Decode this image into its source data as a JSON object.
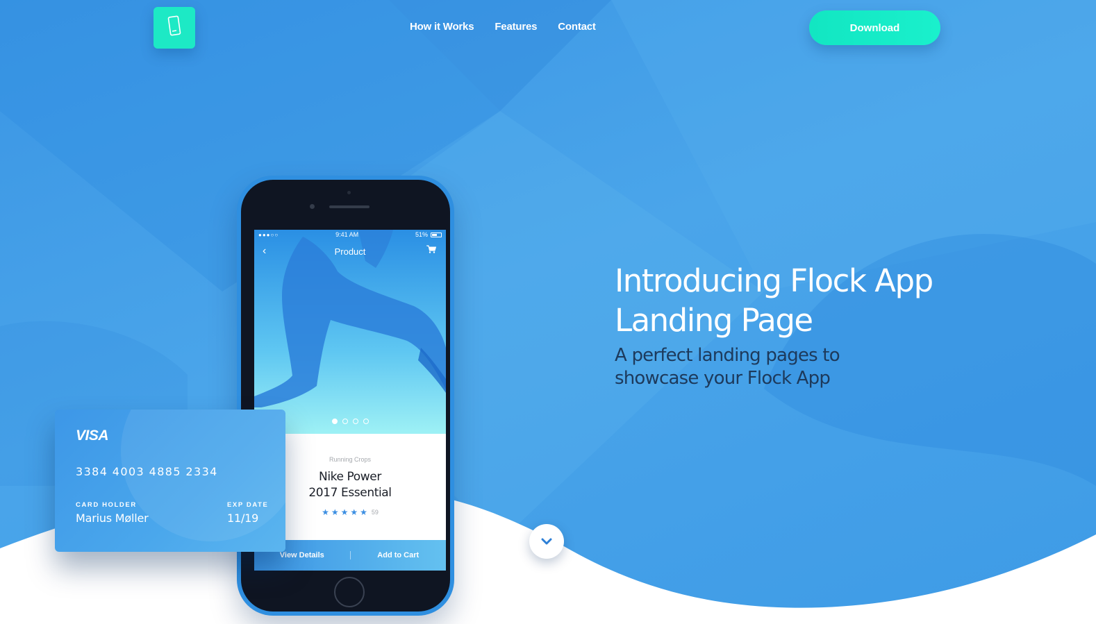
{
  "nav": {
    "items": [
      "How it Works",
      "Features",
      "Contact"
    ],
    "download_label": "Download"
  },
  "hero": {
    "title": "Introducing Flock App Landing Page",
    "subtitle": "A perfect landing pages to showcase your Flock App"
  },
  "phone": {
    "status": {
      "signal": "●●●○○",
      "time": "9:41 AM",
      "battery": "51%"
    },
    "screen_title": "Product",
    "product": {
      "category": "Running Crops",
      "name": "Nike Power 2017 Essential",
      "rating_stars": 5,
      "rating_count": "59"
    },
    "actions": {
      "view_details": "View Details",
      "add_to_cart": "Add to Cart"
    }
  },
  "card": {
    "brand": "VISA",
    "number": "3384 4003 4885 2334",
    "holder_label": "CARD HOLDER",
    "holder_name": "Marius Møller",
    "exp_label": "EXP DATE",
    "exp_value": "11/19"
  },
  "icons": {
    "logo": "smartphone-icon",
    "scroll": "chevron-down-icon",
    "back": "chevron-left-icon",
    "cart": "cart-icon"
  },
  "colors": {
    "background": "#3e9be6",
    "accent": "#1de9c5",
    "text_dark": "#1d3a5c"
  }
}
